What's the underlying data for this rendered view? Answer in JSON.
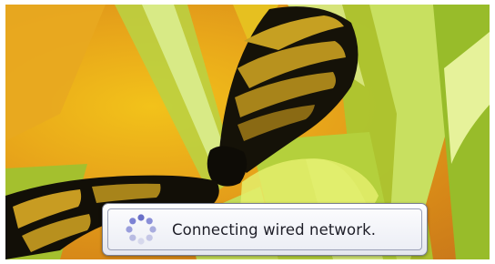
{
  "notification": {
    "icon": "loading-spinner-icon",
    "message": "Connecting wired network."
  },
  "colors": {
    "spinner_dots": "#8a8fd8",
    "panel_border": "#7a7f90",
    "text": "#1e1e28"
  }
}
